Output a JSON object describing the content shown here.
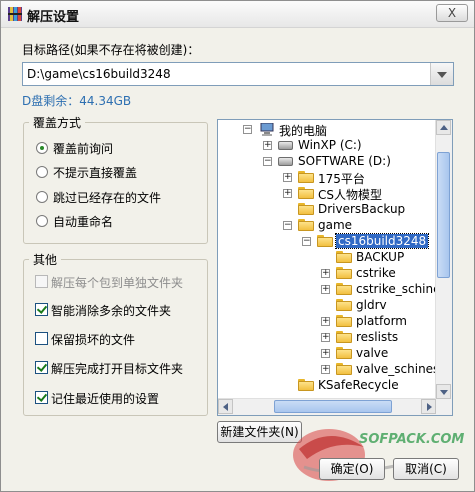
{
  "window": {
    "title": "解压设置",
    "close_label": "X"
  },
  "target": {
    "label": "目标路径(如果不存在将被创建)：",
    "value": "D:\\game\\cs16build3248",
    "free_space": "D盘剩余：44.34GB"
  },
  "overwrite": {
    "title": "覆盖方式",
    "options": [
      "覆盖前询问",
      "不提示直接覆盖",
      "跳过已经存在的文件",
      "自动重命名"
    ],
    "selected_index": 0
  },
  "other": {
    "title": "其他",
    "options": [
      {
        "label": "解压每个包到单独文件夹",
        "checked": false,
        "disabled": true
      },
      {
        "label": "智能消除多余的文件夹",
        "checked": true,
        "disabled": false
      },
      {
        "label": "保留损坏的文件",
        "checked": false,
        "disabled": false
      },
      {
        "label": "解压完成打开目标文件夹",
        "checked": true,
        "disabled": false
      },
      {
        "label": "记住最近使用的设置",
        "checked": true,
        "disabled": false
      }
    ]
  },
  "tree": {
    "nodes": [
      {
        "label": "我的电脑",
        "expander": "−",
        "icon": "computer-icon"
      },
      {
        "label": "WinXP (C:)",
        "expander": "+",
        "icon": "drive-icon"
      },
      {
        "label": "SOFTWARE (D:)",
        "expander": "−",
        "icon": "drive-icon"
      },
      {
        "label": "175平台",
        "expander": "+",
        "icon": "folder-icon"
      },
      {
        "label": "CS人物模型",
        "expander": "+",
        "icon": "folder-icon"
      },
      {
        "label": "DriversBackup",
        "expander": "",
        "icon": "folder-icon"
      },
      {
        "label": "game",
        "expander": "−",
        "icon": "folder-icon"
      },
      {
        "label": "cs16build3248",
        "expander": "−",
        "icon": "folder-open-icon",
        "selected": true
      },
      {
        "label": "BACKUP",
        "expander": "",
        "icon": "folder-icon"
      },
      {
        "label": "cstrike",
        "expander": "+",
        "icon": "folder-icon"
      },
      {
        "label": "cstrike_schines",
        "expander": "+",
        "icon": "folder-icon"
      },
      {
        "label": "gldrv",
        "expander": "",
        "icon": "folder-icon"
      },
      {
        "label": "platform",
        "expander": "+",
        "icon": "folder-icon"
      },
      {
        "label": "reslists",
        "expander": "+",
        "icon": "folder-icon"
      },
      {
        "label": "valve",
        "expander": "+",
        "icon": "folder-icon"
      },
      {
        "label": "valve_schinese",
        "expander": "+",
        "icon": "folder-icon"
      },
      {
        "label": "KSafeRecycle",
        "expander": "",
        "icon": "folder-icon"
      }
    ]
  },
  "buttons": {
    "new_folder": "新建文件夹(N)",
    "ok": "确定(O)",
    "cancel": "取消(C)"
  },
  "watermark": "SOFPACK.COM",
  "colors": {
    "accent": "#316ac5",
    "free_space": "#2d6fb1",
    "check": "#1a7a1a"
  }
}
